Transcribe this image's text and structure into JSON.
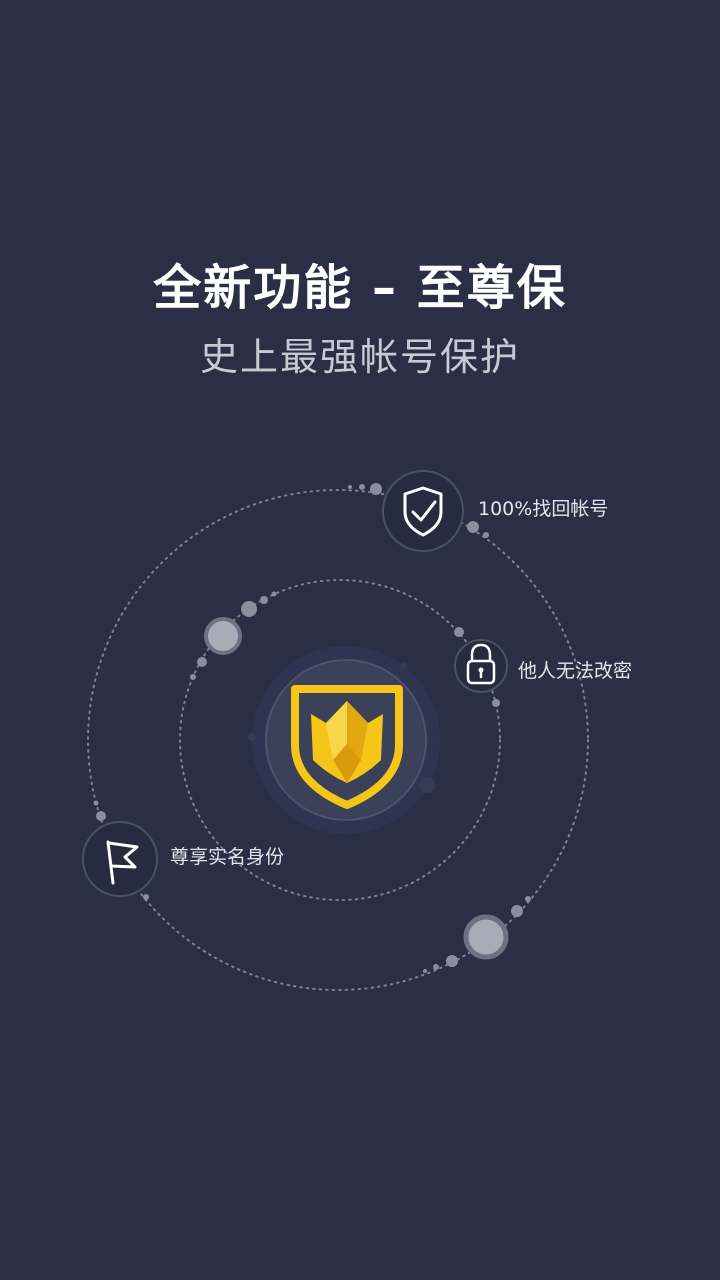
{
  "headline": "全新功能 – 至尊保",
  "subheadline": "史上最强帐号保护",
  "features": [
    {
      "label": "100%找回帐号",
      "icon": "shield-check-icon"
    },
    {
      "label": "他人无法改密",
      "icon": "padlock-icon"
    },
    {
      "label": "尊享实名身份",
      "icon": "flag-icon"
    }
  ],
  "center_icon": "crown-shield-icon",
  "colors": {
    "background": "#2a2f45",
    "accent": "#f5c518",
    "text": "#ffffff",
    "muted": "#c7cad3"
  }
}
